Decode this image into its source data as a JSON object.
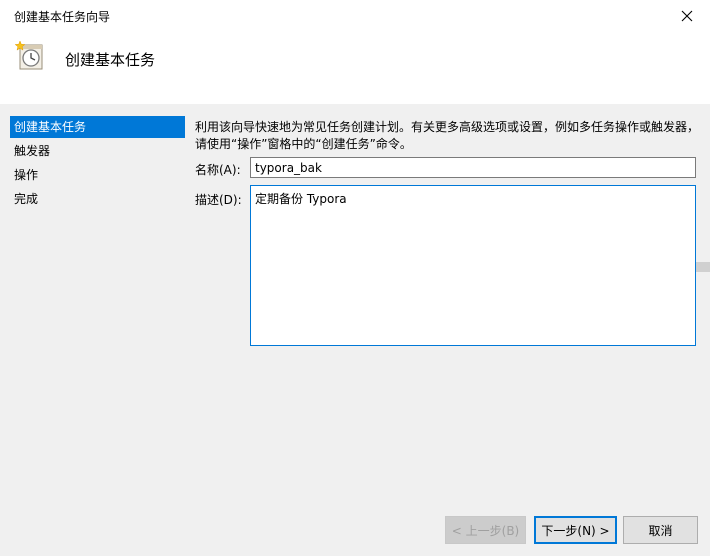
{
  "window": {
    "title": "创建基本任务向导"
  },
  "header": {
    "title": "创建基本任务"
  },
  "sidebar": {
    "items": [
      {
        "label": "创建基本任务"
      },
      {
        "label": "触发器"
      },
      {
        "label": "操作"
      },
      {
        "label": "完成"
      }
    ]
  },
  "main": {
    "description": "利用该向导快速地为常见任务创建计划。有关更多高级选项或设置，例如多任务操作或触发器，请使用“操作”窗格中的“创建任务”命令。",
    "name_label": "名称(A):",
    "name_value": "typora_bak",
    "desc_label": "描述(D):",
    "desc_value": "定期备份 Typora"
  },
  "buttons": {
    "back": "< 上一步(B)",
    "next": "下一步(N) >",
    "cancel": "取消"
  }
}
